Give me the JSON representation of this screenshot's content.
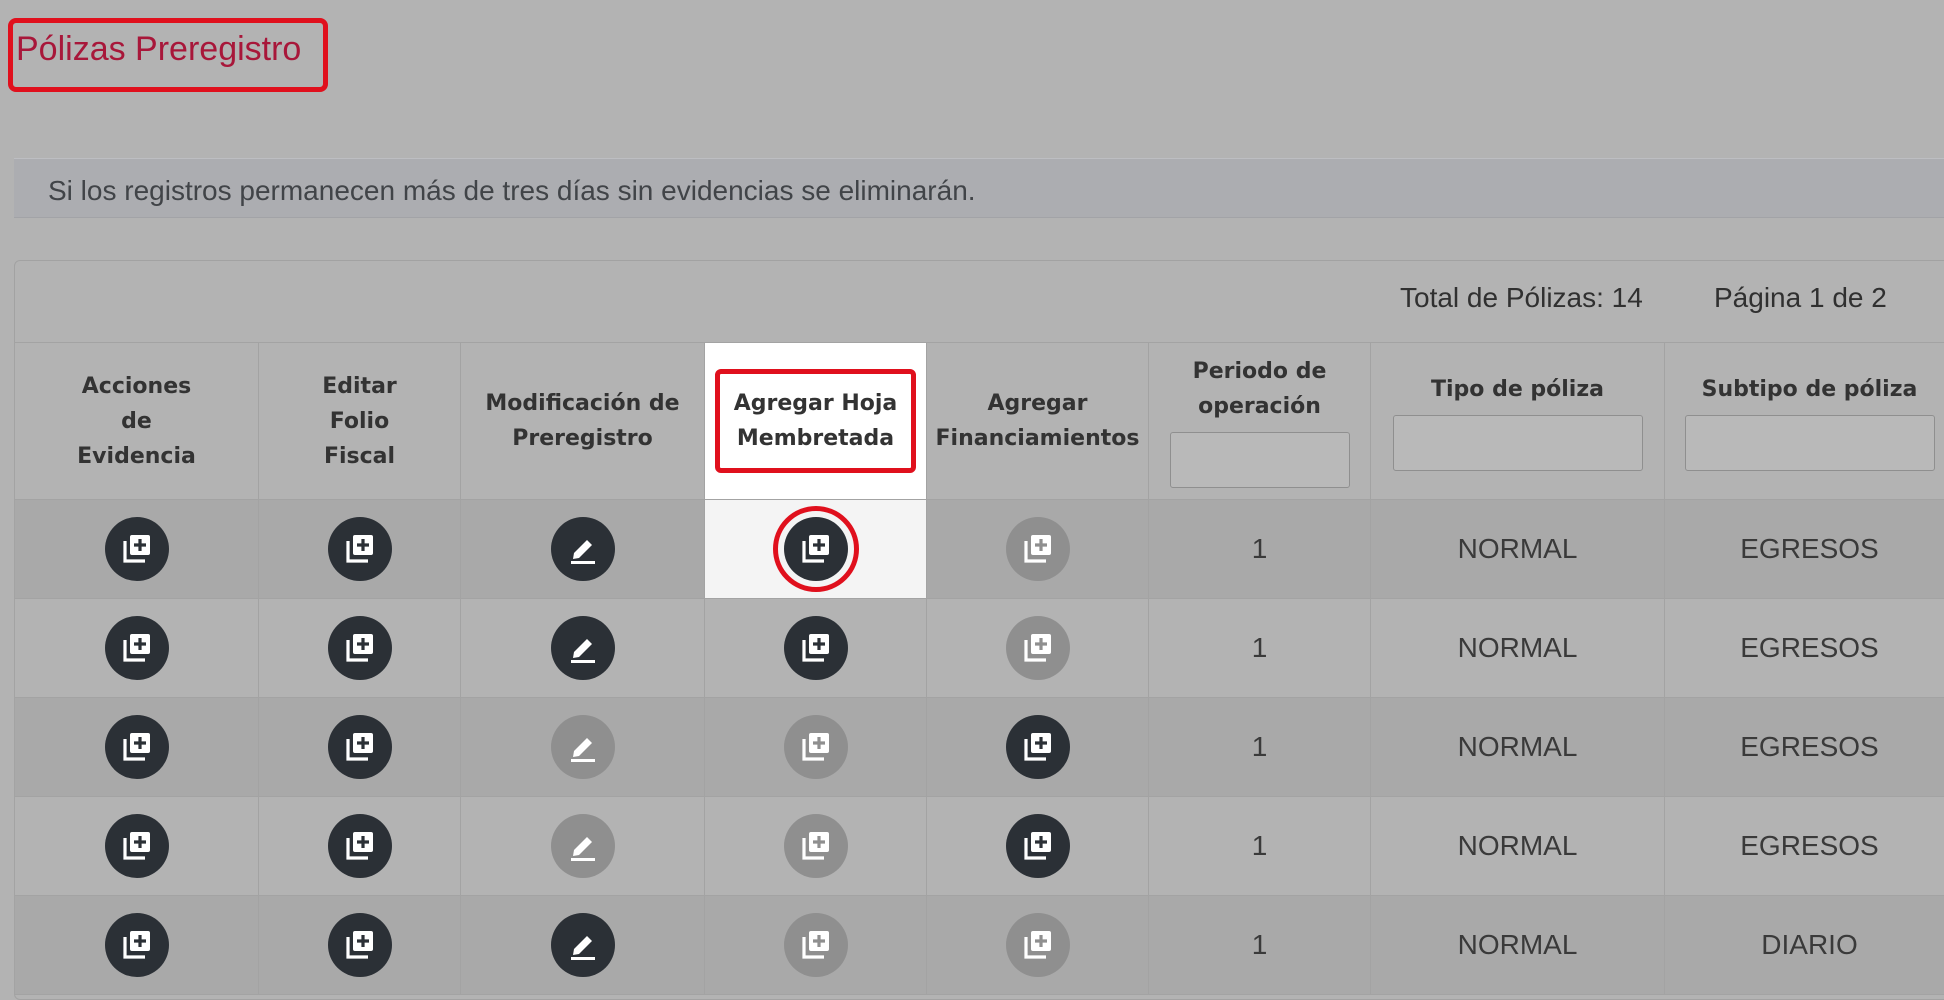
{
  "page": {
    "title": "Pólizas Preregistro",
    "notice": "Si los registros permanecen más de tres días sin evidencias se eliminarán.",
    "total_label": "Total de Pólizas: 14",
    "page_label": "Página 1 de 2"
  },
  "colors": {
    "highlight": "#e0101d",
    "title": "#a8173a",
    "icon_enabled": "#2b3036",
    "icon_disabled": "#8f8f8f"
  },
  "table": {
    "columns": [
      {
        "label": "Acciones de Evidencia",
        "lines": [
          "Acciones",
          "de",
          "Evidencia"
        ]
      },
      {
        "label": "Editar Folio Fiscal",
        "lines": [
          "Editar",
          "Folio",
          "Fiscal"
        ]
      },
      {
        "label": "Modificación de Preregistro",
        "lines": [
          "Modificación de",
          "Preregistro"
        ]
      },
      {
        "label": "Agregar Hoja Membretada",
        "lines": [
          "Agregar Hoja",
          "Membretada"
        ]
      },
      {
        "label": "Agregar Financiamientos",
        "lines": [
          "Agregar",
          "Financiamientos"
        ]
      },
      {
        "label": "Periodo de operación",
        "lines": [
          "Periodo de",
          "operación"
        ]
      },
      {
        "label": "Tipo de póliza",
        "lines": [
          "Tipo de póliza"
        ]
      },
      {
        "label": "Subtipo de póliza",
        "lines": [
          "Subtipo de póliza"
        ]
      }
    ],
    "rows": [
      {
        "evidencia": "add-document-icon",
        "folio": "add-document-icon",
        "modificacion": "edit-pencil-icon",
        "modificacion_enabled": true,
        "hoja": "add-document-icon",
        "hoja_enabled": true,
        "financiamiento_enabled": false,
        "periodo": "1",
        "tipo": "NORMAL",
        "subtipo": "EGRESOS"
      },
      {
        "evidencia": "add-document-icon",
        "folio": "add-document-icon",
        "modificacion": "edit-pencil-icon",
        "modificacion_enabled": true,
        "hoja": "add-document-icon",
        "hoja_enabled": true,
        "financiamiento_enabled": false,
        "periodo": "1",
        "tipo": "NORMAL",
        "subtipo": "EGRESOS"
      },
      {
        "evidencia": "add-document-icon",
        "folio": "add-document-icon",
        "modificacion": "edit-pencil-icon",
        "modificacion_enabled": false,
        "hoja": "add-document-icon",
        "hoja_enabled": false,
        "financiamiento_enabled": true,
        "periodo": "1",
        "tipo": "NORMAL",
        "subtipo": "EGRESOS"
      },
      {
        "evidencia": "add-document-icon",
        "folio": "add-document-icon",
        "modificacion": "edit-pencil-icon",
        "modificacion_enabled": false,
        "hoja": "add-document-icon",
        "hoja_enabled": false,
        "financiamiento_enabled": true,
        "periodo": "1",
        "tipo": "NORMAL",
        "subtipo": "EGRESOS"
      },
      {
        "evidencia": "add-document-icon",
        "folio": "add-document-icon",
        "modificacion": "edit-pencil-icon",
        "modificacion_enabled": true,
        "hoja": "add-document-icon",
        "hoja_enabled": false,
        "financiamiento_enabled": false,
        "periodo": "1",
        "tipo": "NORMAL",
        "subtipo": "DIARIO"
      }
    ]
  }
}
